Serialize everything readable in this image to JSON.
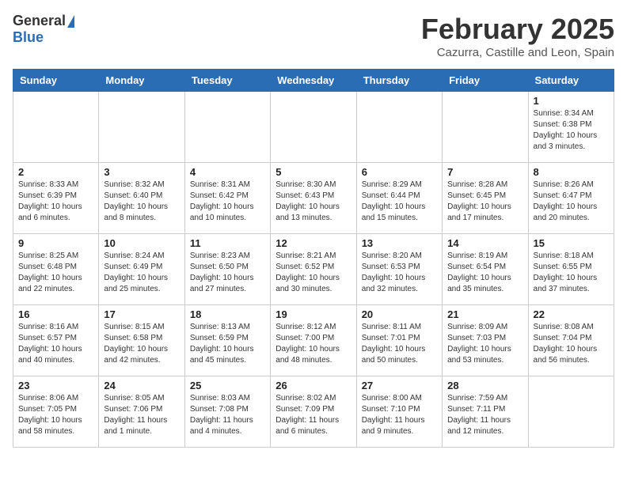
{
  "header": {
    "logo_general": "General",
    "logo_blue": "Blue",
    "month": "February 2025",
    "location": "Cazurra, Castille and Leon, Spain"
  },
  "days_of_week": [
    "Sunday",
    "Monday",
    "Tuesday",
    "Wednesday",
    "Thursday",
    "Friday",
    "Saturday"
  ],
  "weeks": [
    [
      {
        "day": "",
        "info": ""
      },
      {
        "day": "",
        "info": ""
      },
      {
        "day": "",
        "info": ""
      },
      {
        "day": "",
        "info": ""
      },
      {
        "day": "",
        "info": ""
      },
      {
        "day": "",
        "info": ""
      },
      {
        "day": "1",
        "info": "Sunrise: 8:34 AM\nSunset: 6:38 PM\nDaylight: 10 hours and 3 minutes."
      }
    ],
    [
      {
        "day": "2",
        "info": "Sunrise: 8:33 AM\nSunset: 6:39 PM\nDaylight: 10 hours and 6 minutes."
      },
      {
        "day": "3",
        "info": "Sunrise: 8:32 AM\nSunset: 6:40 PM\nDaylight: 10 hours and 8 minutes."
      },
      {
        "day": "4",
        "info": "Sunrise: 8:31 AM\nSunset: 6:42 PM\nDaylight: 10 hours and 10 minutes."
      },
      {
        "day": "5",
        "info": "Sunrise: 8:30 AM\nSunset: 6:43 PM\nDaylight: 10 hours and 13 minutes."
      },
      {
        "day": "6",
        "info": "Sunrise: 8:29 AM\nSunset: 6:44 PM\nDaylight: 10 hours and 15 minutes."
      },
      {
        "day": "7",
        "info": "Sunrise: 8:28 AM\nSunset: 6:45 PM\nDaylight: 10 hours and 17 minutes."
      },
      {
        "day": "8",
        "info": "Sunrise: 8:26 AM\nSunset: 6:47 PM\nDaylight: 10 hours and 20 minutes."
      }
    ],
    [
      {
        "day": "9",
        "info": "Sunrise: 8:25 AM\nSunset: 6:48 PM\nDaylight: 10 hours and 22 minutes."
      },
      {
        "day": "10",
        "info": "Sunrise: 8:24 AM\nSunset: 6:49 PM\nDaylight: 10 hours and 25 minutes."
      },
      {
        "day": "11",
        "info": "Sunrise: 8:23 AM\nSunset: 6:50 PM\nDaylight: 10 hours and 27 minutes."
      },
      {
        "day": "12",
        "info": "Sunrise: 8:21 AM\nSunset: 6:52 PM\nDaylight: 10 hours and 30 minutes."
      },
      {
        "day": "13",
        "info": "Sunrise: 8:20 AM\nSunset: 6:53 PM\nDaylight: 10 hours and 32 minutes."
      },
      {
        "day": "14",
        "info": "Sunrise: 8:19 AM\nSunset: 6:54 PM\nDaylight: 10 hours and 35 minutes."
      },
      {
        "day": "15",
        "info": "Sunrise: 8:18 AM\nSunset: 6:55 PM\nDaylight: 10 hours and 37 minutes."
      }
    ],
    [
      {
        "day": "16",
        "info": "Sunrise: 8:16 AM\nSunset: 6:57 PM\nDaylight: 10 hours and 40 minutes."
      },
      {
        "day": "17",
        "info": "Sunrise: 8:15 AM\nSunset: 6:58 PM\nDaylight: 10 hours and 42 minutes."
      },
      {
        "day": "18",
        "info": "Sunrise: 8:13 AM\nSunset: 6:59 PM\nDaylight: 10 hours and 45 minutes."
      },
      {
        "day": "19",
        "info": "Sunrise: 8:12 AM\nSunset: 7:00 PM\nDaylight: 10 hours and 48 minutes."
      },
      {
        "day": "20",
        "info": "Sunrise: 8:11 AM\nSunset: 7:01 PM\nDaylight: 10 hours and 50 minutes."
      },
      {
        "day": "21",
        "info": "Sunrise: 8:09 AM\nSunset: 7:03 PM\nDaylight: 10 hours and 53 minutes."
      },
      {
        "day": "22",
        "info": "Sunrise: 8:08 AM\nSunset: 7:04 PM\nDaylight: 10 hours and 56 minutes."
      }
    ],
    [
      {
        "day": "23",
        "info": "Sunrise: 8:06 AM\nSunset: 7:05 PM\nDaylight: 10 hours and 58 minutes."
      },
      {
        "day": "24",
        "info": "Sunrise: 8:05 AM\nSunset: 7:06 PM\nDaylight: 11 hours and 1 minute."
      },
      {
        "day": "25",
        "info": "Sunrise: 8:03 AM\nSunset: 7:08 PM\nDaylight: 11 hours and 4 minutes."
      },
      {
        "day": "26",
        "info": "Sunrise: 8:02 AM\nSunset: 7:09 PM\nDaylight: 11 hours and 6 minutes."
      },
      {
        "day": "27",
        "info": "Sunrise: 8:00 AM\nSunset: 7:10 PM\nDaylight: 11 hours and 9 minutes."
      },
      {
        "day": "28",
        "info": "Sunrise: 7:59 AM\nSunset: 7:11 PM\nDaylight: 11 hours and 12 minutes."
      },
      {
        "day": "",
        "info": ""
      }
    ]
  ]
}
